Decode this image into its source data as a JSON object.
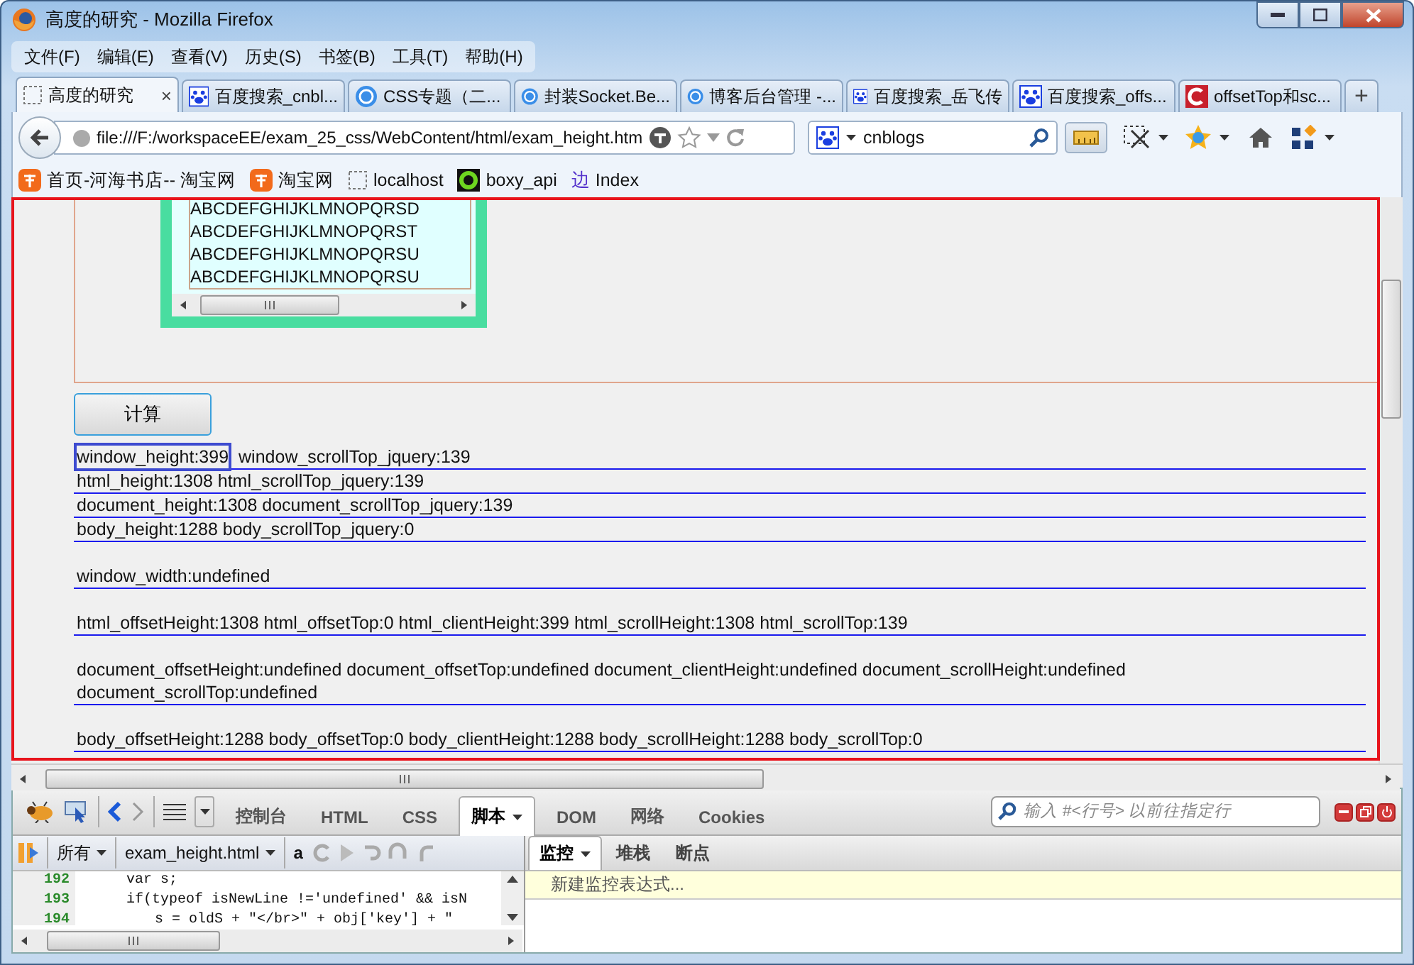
{
  "window": {
    "title": "高度的研究 - Mozilla Firefox"
  },
  "menu": [
    "文件(F)",
    "编辑(E)",
    "查看(V)",
    "历史(S)",
    "书签(B)",
    "工具(T)",
    "帮助(H)"
  ],
  "tabs": [
    {
      "label": "高度的研究",
      "selected": true
    },
    {
      "label": "百度搜索_cnbl...",
      "selected": false
    },
    {
      "label": "CSS专题（二...",
      "selected": false
    },
    {
      "label": "封装Socket.Be...",
      "selected": false
    },
    {
      "label": "博客后台管理 -...",
      "selected": false
    },
    {
      "label": "百度搜索_岳飞传",
      "selected": false
    },
    {
      "label": "百度搜索_offs...",
      "selected": false
    },
    {
      "label": "offsetTop和sc...",
      "selected": false
    }
  ],
  "tab_close": "×",
  "new_tab": "+",
  "url": "file:///F:/workspaceEE/exam_25_css/WebContent/html/exam_height.htm",
  "search": {
    "value": "cnblogs"
  },
  "bookmarks": [
    {
      "label": "首页-河海书店-- 淘宝网"
    },
    {
      "label": "淘宝网"
    },
    {
      "label": "localhost"
    },
    {
      "label": "boxy_api"
    },
    {
      "label": "Index",
      "glyph": "边"
    }
  ],
  "page": {
    "textarea_lines": [
      "ABCDEFGHIJKLMNOPQRSD",
      "ABCDEFGHIJKLMNOPQRST",
      "ABCDEFGHIJKLMNOPQRSU",
      "ABCDEFGHIJKLMNOPQRSU"
    ],
    "button": "计算",
    "blocks": [
      {
        "lines": [
          {
            "segments": [
              {
                "text": "window_height:399",
                "boxed": true
              },
              {
                "text": "window_scrollTop_jquery:139",
                "boxed": false
              }
            ]
          },
          {
            "segments": [
              {
                "text": "html_height:1308 html_scrollTop_jquery:139",
                "boxed": false
              }
            ]
          },
          {
            "segments": [
              {
                "text": "document_height:1308 document_scrollTop_jquery:139",
                "boxed": false
              }
            ]
          },
          {
            "segments": [
              {
                "text": "body_height:1288 body_scrollTop_jquery:0",
                "boxed": false
              }
            ]
          }
        ]
      },
      {
        "lines": [
          {
            "segments": [
              {
                "text": "window_width:undefined",
                "boxed": false
              }
            ]
          }
        ]
      },
      {
        "lines": [
          {
            "segments": [
              {
                "text": "html_offsetHeight:1308 html_offsetTop:0 html_clientHeight:399 html_scrollHeight:1308 html_scrollTop:139",
                "boxed": false
              }
            ]
          }
        ]
      },
      {
        "lines": [
          {
            "segments": [
              {
                "text": "document_offsetHeight:undefined document_offsetTop:undefined document_clientHeight:undefined document_scrollHeight:undefined document_scrollTop:undefined",
                "boxed": false
              }
            ]
          }
        ]
      },
      {
        "lines": [
          {
            "segments": [
              {
                "text": "body_offsetHeight:1288 body_offsetTop:0 body_clientHeight:1288 body_scrollHeight:1288 body_scrollTop:0",
                "boxed": false
              }
            ]
          }
        ]
      }
    ]
  },
  "firebug": {
    "panels": [
      {
        "label": "控制台",
        "selected": false,
        "dropdown": false
      },
      {
        "label": "HTML",
        "selected": false,
        "dropdown": false
      },
      {
        "label": "CSS",
        "selected": false,
        "dropdown": false
      },
      {
        "label": "脚本",
        "selected": true,
        "dropdown": true
      },
      {
        "label": "DOM",
        "selected": false,
        "dropdown": false
      },
      {
        "label": "网络",
        "selected": false,
        "dropdown": false
      },
      {
        "label": "Cookies",
        "selected": false,
        "dropdown": false
      }
    ],
    "search_placeholder": "输入 #<行号> 以前往指定行",
    "filter": "所有",
    "file": "exam_height.html",
    "toggle_label": "a",
    "code_lines": [
      {
        "number": "192",
        "code": "var s;"
      },
      {
        "number": "193",
        "code": "if(typeof isNewLine !='undefined' && isN"
      },
      {
        "number": "194",
        "code": "s = oldS + \"</br>\" + obj['key'] + \""
      }
    ],
    "side_tabs": [
      {
        "label": "监控",
        "selected": true,
        "dropdown": true
      },
      {
        "label": "堆栈",
        "selected": false,
        "dropdown": false
      },
      {
        "label": "断点",
        "selected": false,
        "dropdown": false
      }
    ],
    "watch_placeholder": "新建监控表达式..."
  }
}
